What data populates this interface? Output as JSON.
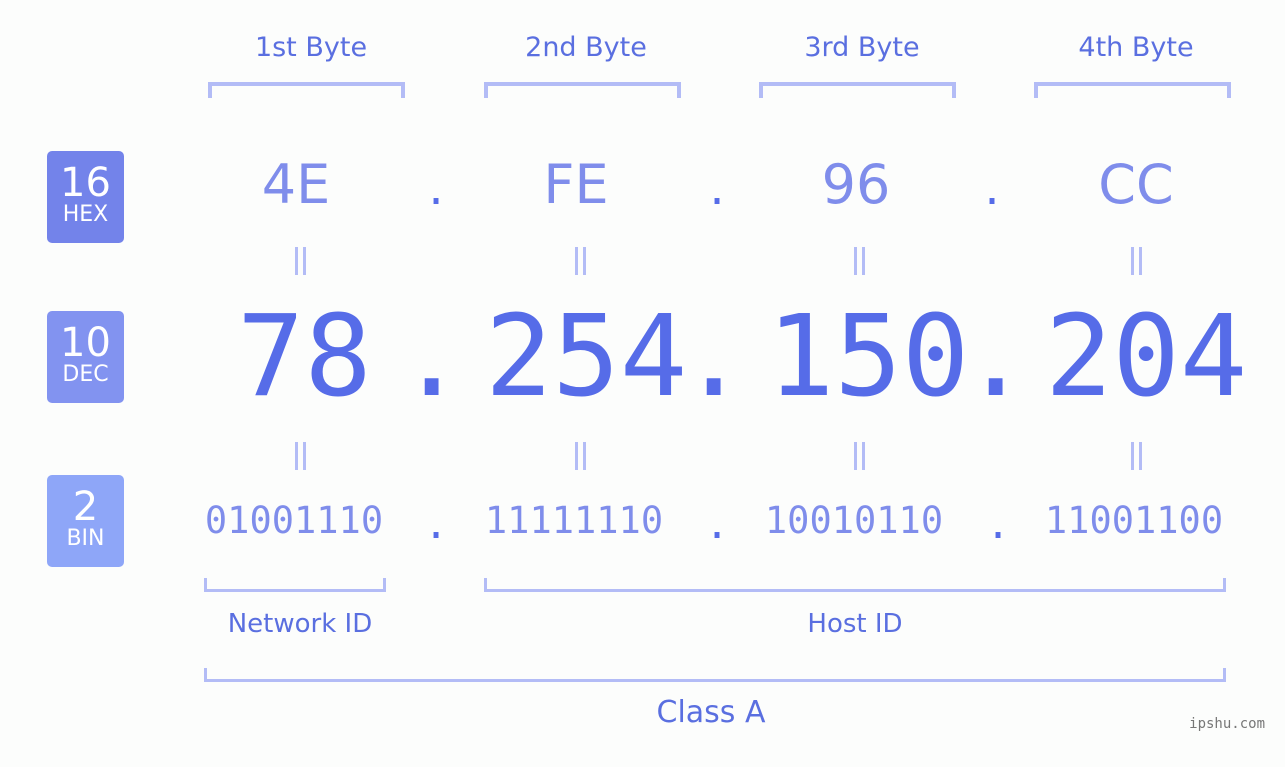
{
  "ip_address": "78.254.150.204",
  "headers": [
    "1st Byte",
    "2nd Byte",
    "3rd Byte",
    "4th Byte"
  ],
  "badges": {
    "hex": {
      "num": "16",
      "label": "HEX",
      "color": "#7383ea"
    },
    "dec": {
      "num": "10",
      "label": "DEC",
      "color": "#8293f0"
    },
    "bin": {
      "num": "2",
      "label": "BIN",
      "color": "#8ea6f8"
    }
  },
  "hex": [
    "4E",
    "FE",
    "96",
    "CC"
  ],
  "dec": [
    "78",
    "254",
    "150",
    "204"
  ],
  "bin": [
    "01001110",
    "11111110",
    "10010110",
    "11001100"
  ],
  "separator": ".",
  "labels": {
    "network_id": "Network ID",
    "host_id": "Host ID",
    "class": "Class A"
  },
  "watermark": "ipshu.com",
  "colors": {
    "primary": "#566ce8",
    "light": "#7f8deb",
    "bracket": "#b3bcf6"
  }
}
